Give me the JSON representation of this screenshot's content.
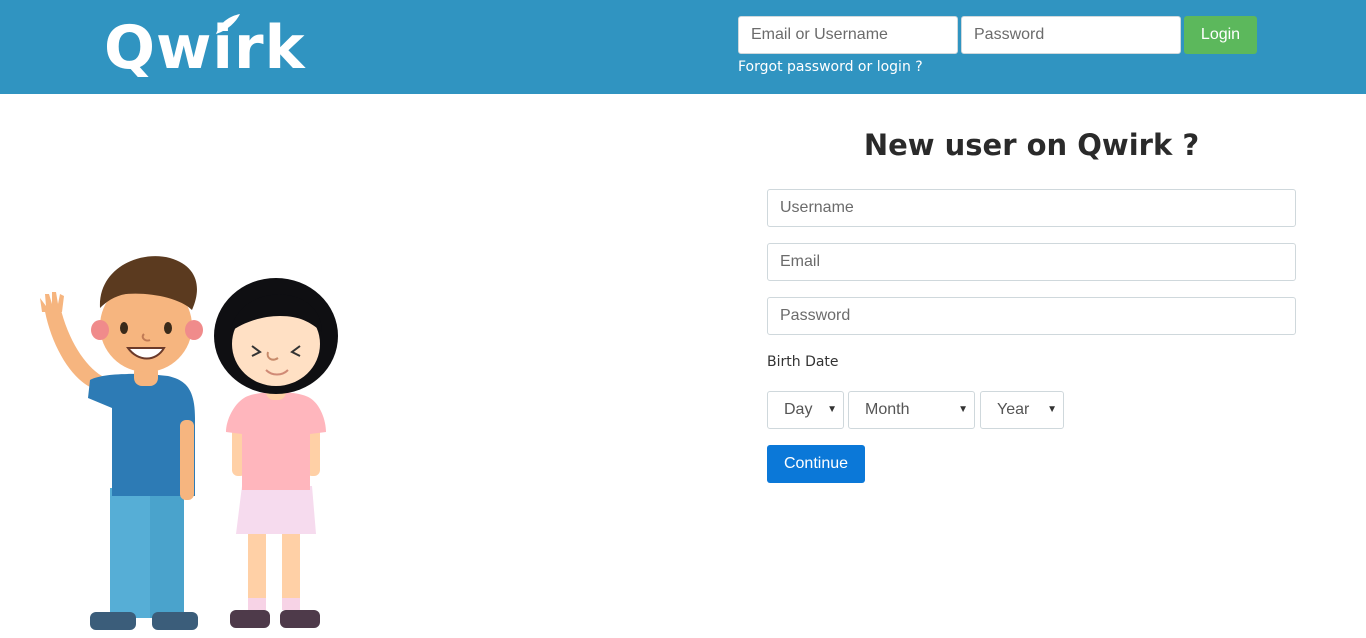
{
  "header": {
    "logo_text": "Qwirk",
    "email_placeholder": "Email or Username",
    "password_placeholder": "Password",
    "login_label": "Login",
    "forgot_link": "Forgot password or login ?"
  },
  "signup": {
    "title": "New user on Qwirk ?",
    "username_placeholder": "Username",
    "email_placeholder": "Email",
    "password_placeholder": "Password",
    "birth_date_label": "Birth Date",
    "day_label": "Day",
    "month_label": "Month",
    "year_label": "Year",
    "continue_label": "Continue"
  },
  "colors": {
    "header_bg": "#3094c1",
    "login_button": "#5cb85c",
    "continue_button": "#0b78d8"
  }
}
